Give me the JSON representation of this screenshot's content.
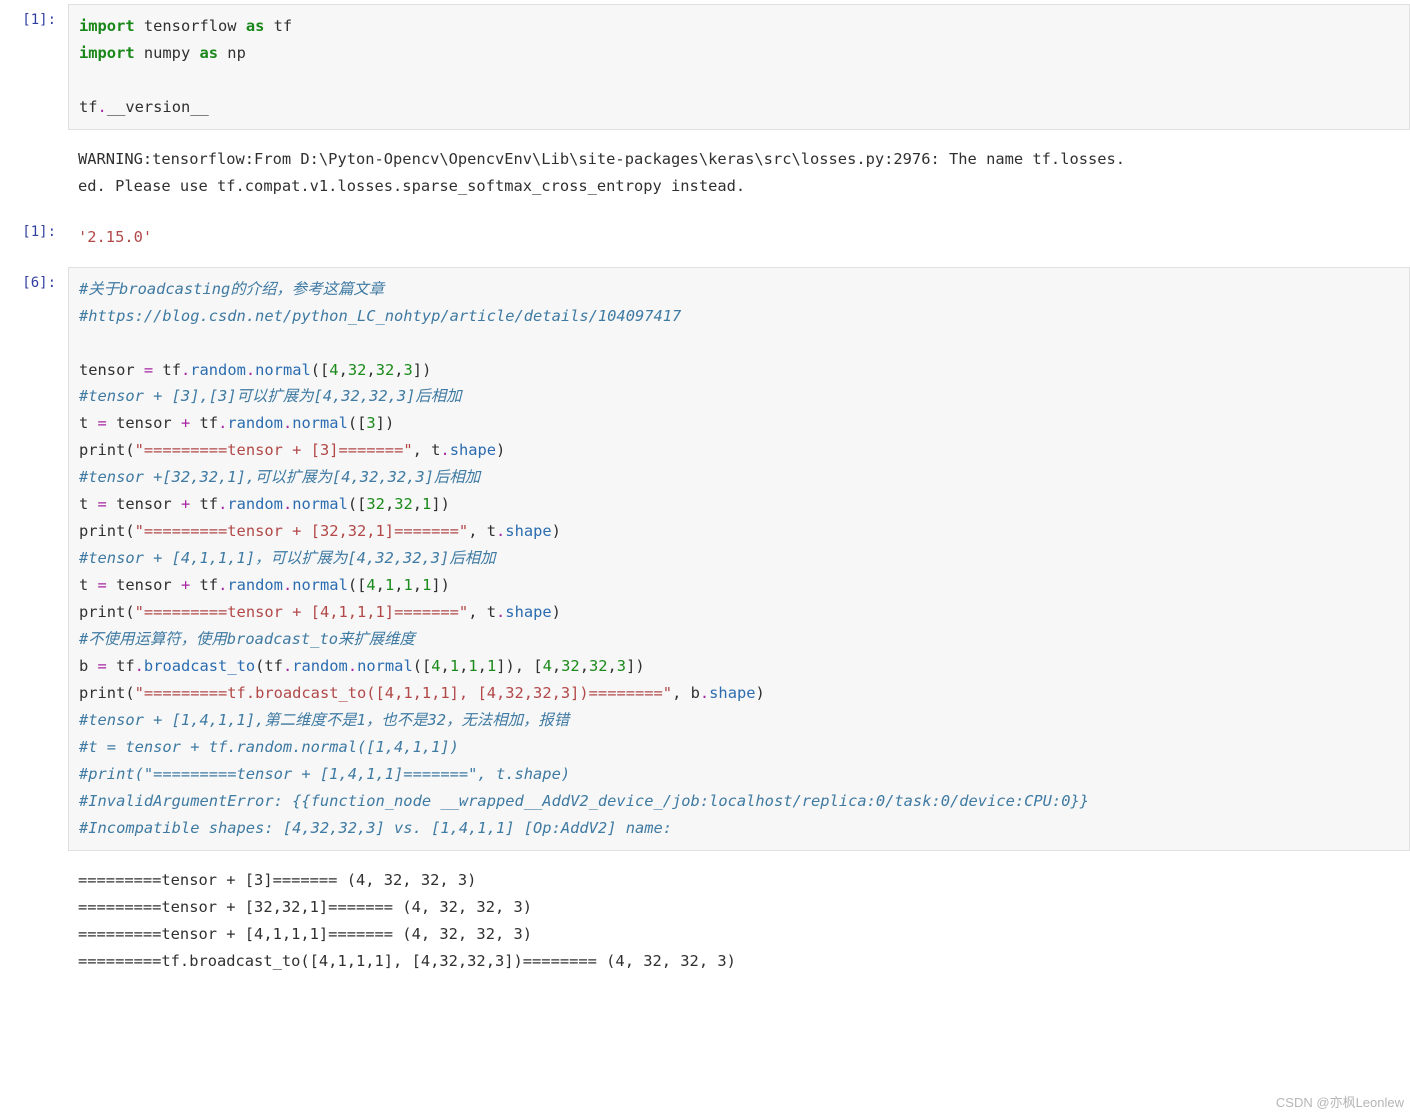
{
  "cells": {
    "c1": {
      "prompt": "[1]:",
      "line1_kw1": "import",
      "line1_mod": " tensorflow ",
      "line1_kw2": "as",
      "line1_alias": " tf",
      "line2_kw1": "import",
      "line2_mod": " numpy ",
      "line2_kw2": "as",
      "line2_alias": " np",
      "line4_a": "tf",
      "line4_b": ".",
      "line4_c": "__version__"
    },
    "warn1": {
      "text": "WARNING:tensorflow:From D:\\Pyton-Opencv\\OpencvEnv\\Lib\\site-packages\\keras\\src\\losses.py:2976: The name tf.losses.\ned. Please use tf.compat.v1.losses.sparse_softmax_cross_entropy instead."
    },
    "out1": {
      "prompt": "[1]:",
      "value": "'2.15.0'"
    },
    "c6": {
      "prompt": "[6]:",
      "l01": "#关于broadcasting的介绍，参考这篇文章",
      "l02": "#https://blog.csdn.net/python_LC_nohtyp/article/details/104097417",
      "l04a": "tensor ",
      "l04b": "=",
      "l04c": " tf",
      "l04d": ".",
      "l04e": "random",
      "l04f": ".",
      "l04g": "normal",
      "l04h": "([",
      "l04i": "4",
      "l04j": ",",
      "l04k": "32",
      "l04l": ",",
      "l04m": "32",
      "l04n": ",",
      "l04o": "3",
      "l04p": "])",
      "l05": "#tensor + [3],[3]可以扩展为[4,32,32,3]后相加",
      "l06a": "t ",
      "l06b": "=",
      "l06c": " tensor ",
      "l06d": "+",
      "l06e": " tf",
      "l06f": ".",
      "l06g": "random",
      "l06h": ".",
      "l06i": "normal",
      "l06j": "([",
      "l06k": "3",
      "l06l": "])",
      "l07a": "print",
      "l07b": "(",
      "l07c": "\"=========tensor + [3]=======\"",
      "l07d": ", t",
      "l07e": ".",
      "l07f": "shape",
      "l07g": ")",
      "l08": "#tensor +[32,32,1],可以扩展为[4,32,32,3]后相加",
      "l09a": "t ",
      "l09b": "=",
      "l09c": " tensor ",
      "l09d": "+",
      "l09e": " tf",
      "l09f": ".",
      "l09g": "random",
      "l09h": ".",
      "l09i": "normal",
      "l09j": "([",
      "l09k": "32",
      "l09l": ",",
      "l09m": "32",
      "l09n": ",",
      "l09o": "1",
      "l09p": "])",
      "l10a": "print",
      "l10b": "(",
      "l10c": "\"=========tensor + [32,32,1]=======\"",
      "l10d": ", t",
      "l10e": ".",
      "l10f": "shape",
      "l10g": ")",
      "l11": "#tensor + [4,1,1,1]，可以扩展为[4,32,32,3]后相加",
      "l12a": "t ",
      "l12b": "=",
      "l12c": " tensor ",
      "l12d": "+",
      "l12e": " tf",
      "l12f": ".",
      "l12g": "random",
      "l12h": ".",
      "l12i": "normal",
      "l12j": "([",
      "l12k": "4",
      "l12l": ",",
      "l12m": "1",
      "l12n": ",",
      "l12o": "1",
      "l12p": ",",
      "l12q": "1",
      "l12r": "])",
      "l13a": "print",
      "l13b": "(",
      "l13c": "\"=========tensor + [4,1,1,1]=======\"",
      "l13d": ", t",
      "l13e": ".",
      "l13f": "shape",
      "l13g": ")",
      "l14": "#不使用运算符，使用broadcast_to来扩展维度",
      "l15a": "b ",
      "l15b": "=",
      "l15c": " tf",
      "l15d": ".",
      "l15e": "broadcast_to",
      "l15f": "(tf",
      "l15g": ".",
      "l15h": "random",
      "l15i": ".",
      "l15j": "normal",
      "l15k": "([",
      "l15l": "4",
      "l15m": ",",
      "l15n": "1",
      "l15o": ",",
      "l15p": "1",
      "l15q": ",",
      "l15r": "1",
      "l15s": "]), [",
      "l15t": "4",
      "l15u": ",",
      "l15v": "32",
      "l15w": ",",
      "l15x": "32",
      "l15y": ",",
      "l15z": "3",
      "l15zz": "])",
      "l16a": "print",
      "l16b": "(",
      "l16c": "\"=========tf.broadcast_to([4,1,1,1], [4,32,32,3])========\"",
      "l16d": ", b",
      "l16e": ".",
      "l16f": "shape",
      "l16g": ")",
      "l17": "#tensor + [1,4,1,1],第二维度不是1，也不是32，无法相加，报错",
      "l18": "#t = tensor + tf.random.normal([1,4,1,1])",
      "l19": "#print(\"=========tensor + [1,4,1,1]=======\", t.shape)",
      "l20": "#InvalidArgumentError: {{function_node __wrapped__AddV2_device_/job:localhost/replica:0/task:0/device:CPU:0}}",
      "l21": "#Incompatible shapes: [4,32,32,3] vs. [1,4,1,1] [Op:AddV2] name:"
    },
    "out6": {
      "text": "=========tensor + [3]======= (4, 32, 32, 3)\n=========tensor + [32,32,1]======= (4, 32, 32, 3)\n=========tensor + [4,1,1,1]======= (4, 32, 32, 3)\n=========tf.broadcast_to([4,1,1,1], [4,32,32,3])======== (4, 32, 32, 3)"
    }
  },
  "watermark": "CSDN @亦枫Leonlew"
}
